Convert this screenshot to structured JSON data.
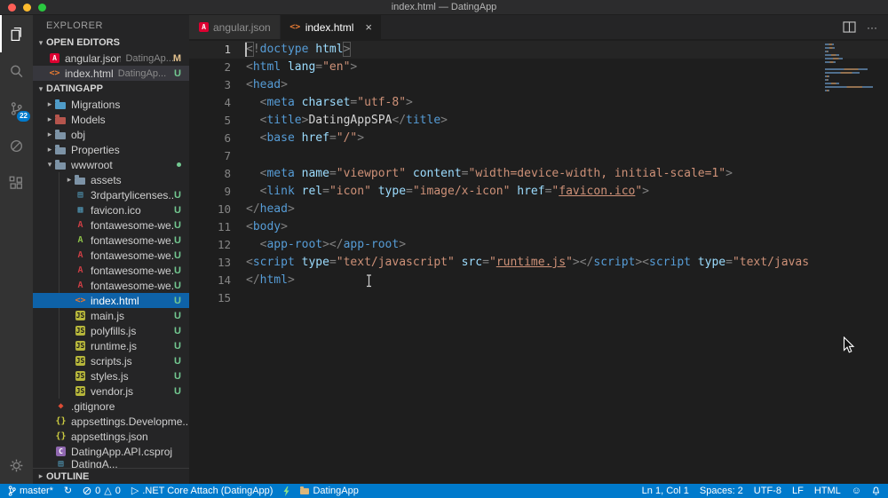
{
  "window": {
    "title": "index.html — DatingApp"
  },
  "colors": {
    "status_bar_bg": "#007acc",
    "selection_bg": "#0e62a8",
    "untracked_badge": "#73c991",
    "modified_badge": "#e2c08d",
    "angular_red": "#dd0031",
    "html_orange": "#e37933"
  },
  "activity_bar": {
    "items": [
      {
        "id": "explorer",
        "active": true
      },
      {
        "id": "search",
        "active": false
      },
      {
        "id": "source-control",
        "active": false,
        "badge": "22"
      },
      {
        "id": "debug",
        "active": false
      },
      {
        "id": "extensions",
        "active": false
      }
    ],
    "scm_badge": "22"
  },
  "sidebar": {
    "title": "EXPLORER",
    "open_editors": {
      "label": "OPEN EDITORS",
      "items": [
        {
          "label": "angular.json",
          "detail": "DatingAp...",
          "badge": "M",
          "icon": "angular",
          "active": false
        },
        {
          "label": "index.html",
          "detail": "DatingAp...",
          "badge": "U",
          "icon": "html",
          "active": true
        }
      ]
    },
    "project": {
      "label": "DATINGAPP",
      "items": [
        {
          "label": "Migrations",
          "kind": "folder",
          "level": 1,
          "folder_color": "#4f9bc8"
        },
        {
          "label": "Models",
          "kind": "folder",
          "level": 1,
          "folder_color": "#b5554d"
        },
        {
          "label": "obj",
          "kind": "folder",
          "level": 1,
          "folder_color": "#7d93a6"
        },
        {
          "label": "Properties",
          "kind": "folder",
          "level": 1,
          "folder_color": "#7d93a6"
        },
        {
          "label": "wwwroot",
          "kind": "folder",
          "level": 1,
          "folder_color": "#7d93a6",
          "expanded": true,
          "git_dot": true
        },
        {
          "label": "assets",
          "kind": "folder",
          "level": 2,
          "folder_color": "#7d93a6"
        },
        {
          "label": "3rdpartylicenses....",
          "icon": "file",
          "level": 2,
          "badge": "U"
        },
        {
          "label": "favicon.ico",
          "icon": "image",
          "level": 2,
          "badge": "U"
        },
        {
          "label": "fontawesome-we...",
          "icon": "font",
          "level": 2,
          "badge": "U"
        },
        {
          "label": "fontawesome-we...",
          "icon": "font-green",
          "level": 2,
          "badge": "U"
        },
        {
          "label": "fontawesome-we...",
          "icon": "font",
          "level": 2,
          "badge": "U"
        },
        {
          "label": "fontawesome-we...",
          "icon": "font",
          "level": 2,
          "badge": "U"
        },
        {
          "label": "fontawesome-we...",
          "icon": "font",
          "level": 2,
          "badge": "U"
        },
        {
          "label": "index.html",
          "icon": "html",
          "level": 2,
          "badge": "U",
          "selected": true
        },
        {
          "label": "main.js",
          "icon": "js",
          "level": 2,
          "badge": "U"
        },
        {
          "label": "polyfills.js",
          "icon": "js",
          "level": 2,
          "badge": "U"
        },
        {
          "label": "runtime.js",
          "icon": "js",
          "level": 2,
          "badge": "U"
        },
        {
          "label": "scripts.js",
          "icon": "js",
          "level": 2,
          "badge": "U"
        },
        {
          "label": "styles.js",
          "icon": "js",
          "level": 2,
          "badge": "U"
        },
        {
          "label": "vendor.js",
          "icon": "js",
          "level": 2,
          "badge": "U"
        },
        {
          "label": ".gitignore",
          "icon": "git",
          "level": 1
        },
        {
          "label": "appsettings.Developme...",
          "icon": "json",
          "level": 1
        },
        {
          "label": "appsettings.json",
          "icon": "json",
          "level": 1
        },
        {
          "label": "DatingApp.API.csproj",
          "icon": "csproj",
          "level": 1
        },
        {
          "label": "DatingA...",
          "icon": "file",
          "level": 1,
          "clipped": true
        }
      ]
    },
    "outline": {
      "label": "OUTLINE"
    }
  },
  "tabs": {
    "items": [
      {
        "label": "angular.json",
        "icon": "angular",
        "active": false
      },
      {
        "label": "index.html",
        "icon": "html",
        "active": true
      }
    ]
  },
  "editor": {
    "lines": [
      [
        [
          "pm",
          "<"
        ],
        [
          "p",
          "!"
        ],
        [
          "tag",
          "doctype"
        ],
        [
          "attr",
          " html"
        ],
        [
          "pm",
          ">"
        ]
      ],
      [
        [
          "p",
          "<"
        ],
        [
          "tag",
          "html"
        ],
        [
          "attr",
          " lang"
        ],
        [
          "p",
          "="
        ],
        [
          "str",
          "\"en\""
        ],
        [
          "p",
          ">"
        ]
      ],
      [
        [
          "p",
          "<"
        ],
        [
          "tag",
          "head"
        ],
        [
          "p",
          ">"
        ]
      ],
      [
        [
          "w",
          "  "
        ],
        [
          "p",
          "<"
        ],
        [
          "tag",
          "meta"
        ],
        [
          "attr",
          " charset"
        ],
        [
          "p",
          "="
        ],
        [
          "str",
          "\"utf-8\""
        ],
        [
          "p",
          ">"
        ]
      ],
      [
        [
          "w",
          "  "
        ],
        [
          "p",
          "<"
        ],
        [
          "tag",
          "title"
        ],
        [
          "p",
          ">"
        ],
        [
          "txt",
          "DatingAppSPA"
        ],
        [
          "p",
          "</"
        ],
        [
          "tag",
          "title"
        ],
        [
          "p",
          ">"
        ]
      ],
      [
        [
          "w",
          "  "
        ],
        [
          "p",
          "<"
        ],
        [
          "tag",
          "base"
        ],
        [
          "attr",
          " href"
        ],
        [
          "p",
          "="
        ],
        [
          "str",
          "\"/\""
        ],
        [
          "p",
          ">"
        ]
      ],
      [],
      [
        [
          "w",
          "  "
        ],
        [
          "p",
          "<"
        ],
        [
          "tag",
          "meta"
        ],
        [
          "attr",
          " name"
        ],
        [
          "p",
          "="
        ],
        [
          "str",
          "\"viewport\""
        ],
        [
          "attr",
          " content"
        ],
        [
          "p",
          "="
        ],
        [
          "str",
          "\"width=device-width, initial-scale=1\""
        ],
        [
          "p",
          ">"
        ]
      ],
      [
        [
          "w",
          "  "
        ],
        [
          "p",
          "<"
        ],
        [
          "tag",
          "link"
        ],
        [
          "attr",
          " rel"
        ],
        [
          "p",
          "="
        ],
        [
          "str",
          "\"icon\""
        ],
        [
          "attr",
          " type"
        ],
        [
          "p",
          "="
        ],
        [
          "str",
          "\"image/x-icon\""
        ],
        [
          "attr",
          " href"
        ],
        [
          "p",
          "="
        ],
        [
          "str",
          "\""
        ],
        [
          "lnk",
          "favicon.ico"
        ],
        [
          "str",
          "\""
        ],
        [
          "p",
          ">"
        ]
      ],
      [
        [
          "p",
          "</"
        ],
        [
          "tag",
          "head"
        ],
        [
          "p",
          ">"
        ]
      ],
      [
        [
          "p",
          "<"
        ],
        [
          "tag",
          "body"
        ],
        [
          "p",
          ">"
        ]
      ],
      [
        [
          "w",
          "  "
        ],
        [
          "p",
          "<"
        ],
        [
          "tag",
          "app-root"
        ],
        [
          "p",
          "></"
        ],
        [
          "tag",
          "app-root"
        ],
        [
          "p",
          ">"
        ]
      ],
      [
        [
          "p",
          "<"
        ],
        [
          "tag",
          "script"
        ],
        [
          "attr",
          " type"
        ],
        [
          "p",
          "="
        ],
        [
          "str",
          "\"text/javascript\""
        ],
        [
          "attr",
          " src"
        ],
        [
          "p",
          "="
        ],
        [
          "str",
          "\""
        ],
        [
          "lnk",
          "runtime.js"
        ],
        [
          "str",
          "\""
        ],
        [
          "p",
          "></"
        ],
        [
          "tag",
          "script"
        ],
        [
          "p",
          "><"
        ],
        [
          "tag",
          "script"
        ],
        [
          "attr",
          " type"
        ],
        [
          "p",
          "="
        ],
        [
          "str",
          "\"text/javas"
        ]
      ],
      [
        [
          "p",
          "</"
        ],
        [
          "tag",
          "html"
        ],
        [
          "p",
          ">"
        ]
      ],
      []
    ]
  },
  "status_bar": {
    "branch": "master*",
    "errors": "0",
    "warnings": "0",
    "debug_target": ".NET Core Attach (DatingApp)",
    "project": "DatingApp",
    "cursor": "Ln 1, Col 1",
    "indentation": "Spaces: 2",
    "encoding": "UTF-8",
    "eol": "LF",
    "language": "HTML"
  }
}
